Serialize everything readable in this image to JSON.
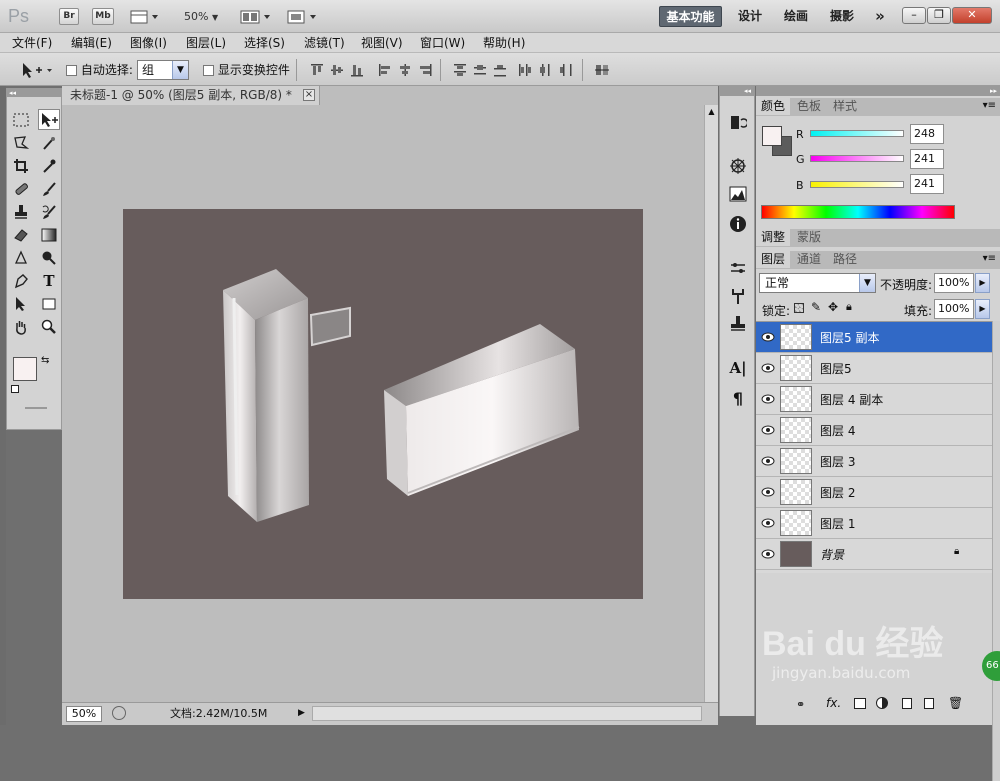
{
  "app": {
    "logo": "Ps",
    "bridge": "Br",
    "minibridge": "Mb",
    "zoom_menu": "50%",
    "workspaces": [
      "基本功能",
      "设计",
      "绘画",
      "摄影"
    ],
    "more": "»"
  },
  "menu": [
    "文件(F)",
    "编辑(E)",
    "图像(I)",
    "图层(L)",
    "选择(S)",
    "滤镜(T)",
    "视图(V)",
    "窗口(W)",
    "帮助(H)"
  ],
  "options": {
    "auto_select_label": "自动选择:",
    "auto_select_value": "组",
    "show_transform_label": "显示变换控件"
  },
  "document": {
    "tab_title": "未标题-1 @ 50% (图层5 副本, RGB/8) *",
    "close": "×",
    "zoom": "50%",
    "doc_info": "文档:2.42M/10.5M"
  },
  "color_panel": {
    "tabs": [
      "颜色",
      "色板",
      "样式"
    ],
    "r_label": "R",
    "r_value": "248",
    "g_label": "G",
    "g_value": "241",
    "b_label": "B",
    "b_value": "241"
  },
  "adjust_panel": {
    "tabs": [
      "调整",
      "蒙版"
    ]
  },
  "layers_panel": {
    "tabs": [
      "图层",
      "通道",
      "路径"
    ],
    "blend_mode": "正常",
    "opacity_label": "不透明度:",
    "opacity_value": "100%",
    "lock_label": "锁定:",
    "fill_label": "填充:",
    "fill_value": "100%",
    "layers": [
      {
        "name": "图层5 副本",
        "selected": true
      },
      {
        "name": "图层5",
        "selected": false
      },
      {
        "name": "图层 4 副本",
        "selected": false
      },
      {
        "name": "图层 4",
        "selected": false
      },
      {
        "name": "图层 3",
        "selected": false
      },
      {
        "name": "图层 2",
        "selected": false
      },
      {
        "name": "图层 1",
        "selected": false
      },
      {
        "name": "背景",
        "selected": false
      }
    ]
  },
  "watermark": {
    "brand": "Bai du 经验",
    "url": "jingyan.baidu.com",
    "badge": "66"
  },
  "colors": {
    "canvas": "#675c5c",
    "fg_swatch": "#f8f1f1",
    "bg_swatch": "#5c5c5c",
    "selected_layer": "#3169c6"
  }
}
